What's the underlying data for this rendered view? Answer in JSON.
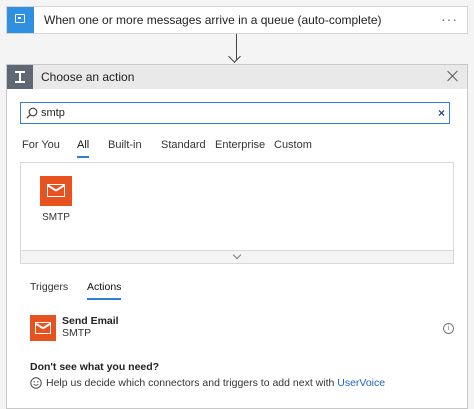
{
  "trigger": {
    "title": "When one or more messages arrive in a queue (auto-complete)",
    "more": "···",
    "icon": "service-bus-queue-icon",
    "color": "#2f8fe0"
  },
  "panel": {
    "title": "Choose an action",
    "icon": "action-step-icon",
    "close_icon": "close-icon"
  },
  "search": {
    "value": "smtp",
    "icon": "search-icon",
    "clear": "×"
  },
  "tabs": [
    {
      "label": "For You",
      "active": false
    },
    {
      "label": "All",
      "active": true
    },
    {
      "label": "Built-in",
      "active": false
    },
    {
      "label": "Standard",
      "active": false
    },
    {
      "label": "Enterprise",
      "active": false
    },
    {
      "label": "Custom",
      "active": false
    }
  ],
  "connectors": [
    {
      "label": "SMTP",
      "icon": "mail-icon",
      "color": "#e8521f"
    }
  ],
  "subtabs": [
    {
      "label": "Triggers",
      "active": false
    },
    {
      "label": "Actions",
      "active": true
    }
  ],
  "actions": [
    {
      "name": "Send Email",
      "connector": "SMTP",
      "icon": "mail-icon",
      "info_icon": "info-icon"
    }
  ],
  "help": {
    "title": "Don't see what you need?",
    "text": "Help us decide which connectors and triggers to add next with ",
    "link": "UserVoice"
  },
  "accent": "#2f7fd6"
}
